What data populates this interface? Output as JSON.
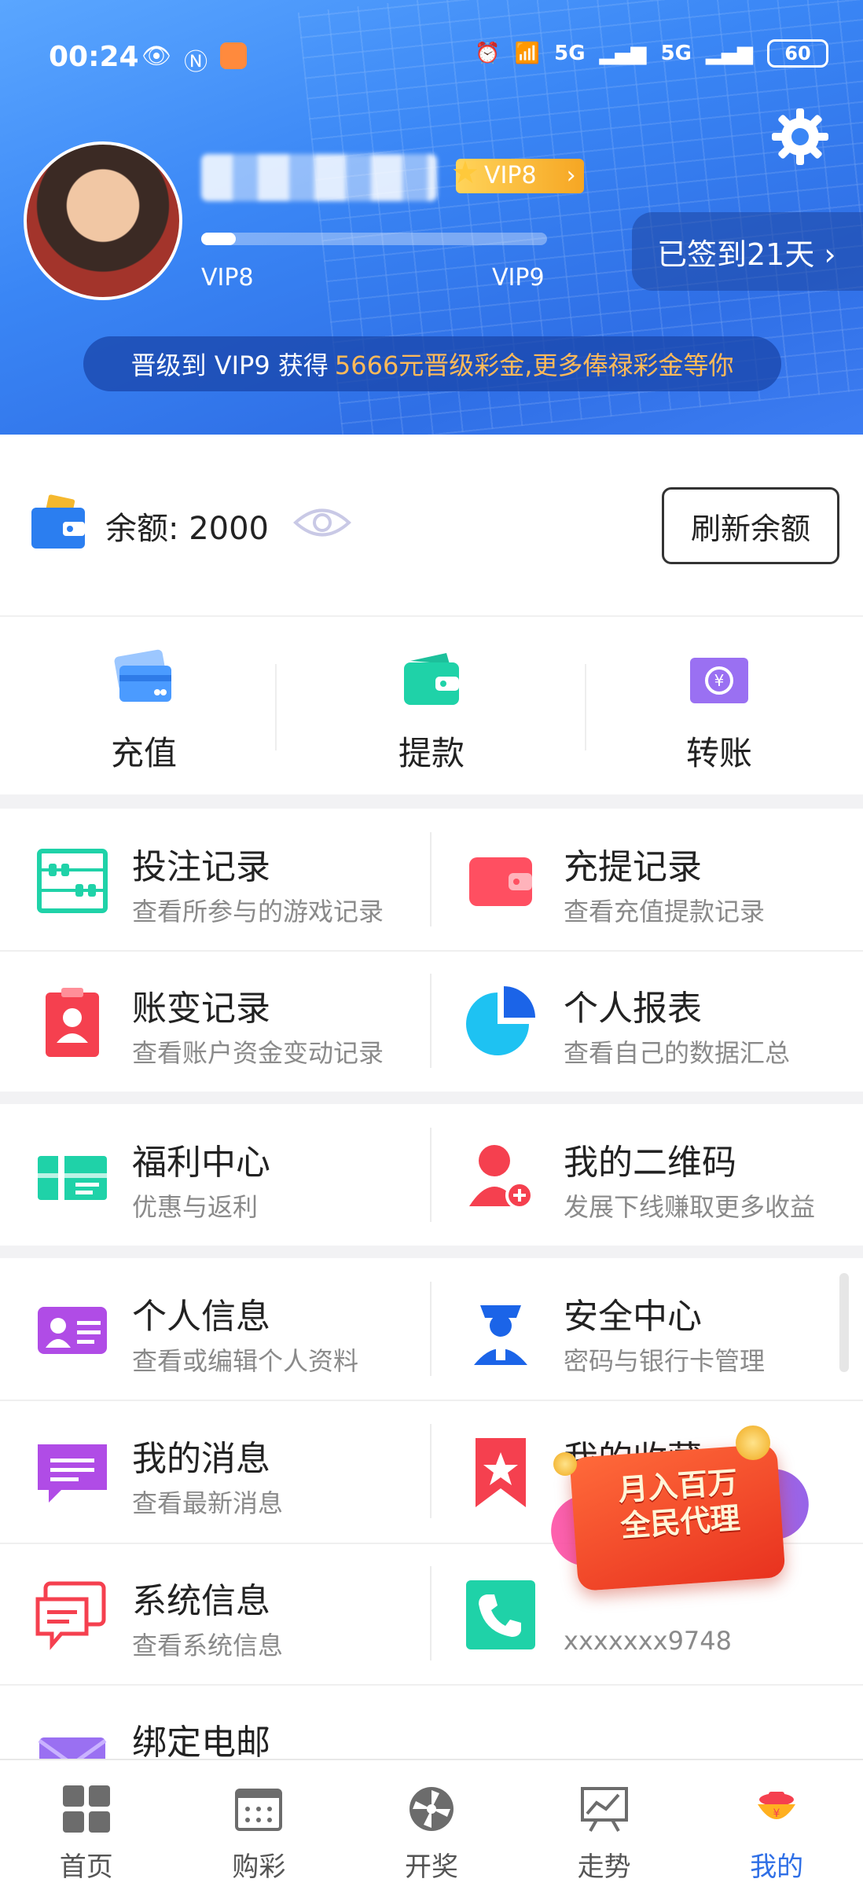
{
  "status_bar": {
    "time": "00:24",
    "battery": "60",
    "network_1": "5G",
    "network_2": "5G"
  },
  "profile": {
    "vip_badge": "VIP8",
    "vip_current": "VIP8",
    "vip_next": "VIP9",
    "vip_progress": 0.1,
    "signin_label": "已签到21天 ›",
    "promo_prefix": "晋级到 VIP9 获得",
    "promo_highlight": "5666元晋级彩金,更多俸禄彩金等你"
  },
  "balance": {
    "label": "余额:",
    "value": "2000",
    "refresh_label": "刷新余额"
  },
  "quick_actions": [
    {
      "label": "充值",
      "icon": "credit-card-icon"
    },
    {
      "label": "提款",
      "icon": "wallet-icon"
    },
    {
      "label": "转账",
      "icon": "transfer-icon"
    }
  ],
  "menu": {
    "bet_records": {
      "title": "投注记录",
      "sub": "查看所参与的游戏记录"
    },
    "deposit_records": {
      "title": "充提记录",
      "sub": "查看充值提款记录"
    },
    "account_changes": {
      "title": "账变记录",
      "sub": "查看账户资金变动记录"
    },
    "personal_report": {
      "title": "个人报表",
      "sub": "查看自己的数据汇总"
    },
    "welfare_center": {
      "title": "福利中心",
      "sub": "优惠与返利"
    },
    "my_qrcode": {
      "title": "我的二维码",
      "sub": "发展下线赚取更多收益"
    },
    "personal_info": {
      "title": "个人信息",
      "sub": "查看或编辑个人资料"
    },
    "security_center": {
      "title": "安全中心",
      "sub": "密码与银行卡管理"
    },
    "my_messages": {
      "title": "我的消息",
      "sub": "查看最新消息"
    },
    "my_favorites": {
      "title": "我的收藏"
    },
    "system_info": {
      "title": "系统信息",
      "sub": "查看系统信息"
    },
    "bind_phone": {
      "sub": "xxxxxxx9748"
    },
    "bind_email": {
      "title": "绑定电邮"
    }
  },
  "float_promo": {
    "line1": "月入百万",
    "line2": "全民代理"
  },
  "bottom_nav": [
    {
      "label": "首页",
      "icon": "home-grid-icon"
    },
    {
      "label": "购彩",
      "icon": "lottery-ticket-icon"
    },
    {
      "label": "开奖",
      "icon": "draw-wheel-icon"
    },
    {
      "label": "走势",
      "icon": "trend-chart-icon"
    },
    {
      "label": "我的",
      "icon": "profile-pot-icon",
      "active": true
    }
  ],
  "colors": {
    "accent": "#2f6fe6",
    "promo_highlight": "#ffba5a",
    "vip_badge": "#f6a623"
  }
}
